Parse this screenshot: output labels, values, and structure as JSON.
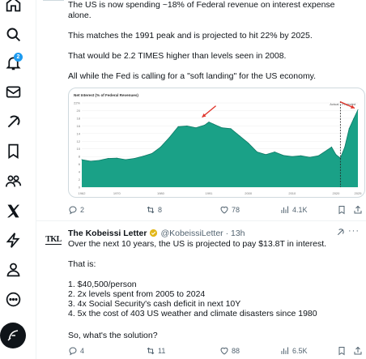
{
  "nav": {
    "items": [
      "home-icon",
      "search-icon",
      "notifications-icon",
      "messages-icon",
      "grok-icon",
      "bookmarks-icon",
      "communities-icon",
      "x-premium-icon",
      "verified-orgs-icon",
      "profile-icon",
      "more-icon"
    ],
    "notification_count": "2"
  },
  "tweet1": {
    "text_top": "The US is now spending ~18% of Federal revenue on interest expense alone.",
    "p2": "This matches the 1991 peak and is projected to hit 22% by 2025.",
    "p3": "That would be 2.2 TIMES higher than levels seen in 2008.",
    "p4": "All while the Fed is calling for a \"soft landing\" for the US economy.",
    "actions": {
      "replies": "2",
      "reposts": "8",
      "likes": "78",
      "views": "4.1K"
    }
  },
  "tweet2": {
    "avatar_text": "TKL",
    "name": "The Kobeissi Letter",
    "handle": "@KobeissiLetter · 13h",
    "intro": "Over the next 10 years, the US is projected to pay $13.8T in interest.",
    "that_is": "That is:",
    "list": [
      "1. $40,500/person",
      "2. 2x levels spent from 2005 to 2024",
      "3. 4x Social Security's cash deficit in next 10Y",
      "4. 5x the cost of 403 US weather and climate disasters since 1980"
    ],
    "question": "So, what's the solution?",
    "actions": {
      "replies": "4",
      "reposts": "11",
      "likes": "88",
      "views": "6.5K"
    }
  },
  "chart_data": {
    "type": "area",
    "title": "Net Interest (% of Federal Revenues)",
    "ylim": [
      0,
      22
    ],
    "yticks": [
      "22%",
      "20",
      "18",
      "16",
      "14",
      "12",
      "10",
      "8",
      "6",
      "4",
      "2",
      "0"
    ],
    "xticks": [
      "1962",
      "1970",
      "1980",
      "1991",
      "2000",
      "2010",
      "2020",
      "2025"
    ],
    "labels": {
      "actual": "Actual",
      "projected": "Projected"
    },
    "x": [
      1962,
      1964,
      1966,
      1968,
      1970,
      1972,
      1974,
      1976,
      1978,
      1980,
      1982,
      1984,
      1986,
      1988,
      1990,
      1991,
      1992,
      1994,
      1996,
      1998,
      2000,
      2002,
      2004,
      2006,
      2008,
      2010,
      2012,
      2014,
      2016,
      2018,
      2019,
      2020,
      2021,
      2022,
      2023,
      2024,
      2025
    ],
    "values": [
      7.2,
      6.8,
      7.0,
      7.5,
      7.6,
      7.2,
      7.5,
      8.1,
      8.8,
      10.5,
      13.0,
      15.8,
      16.0,
      15.5,
      16.2,
      17.0,
      16.5,
      15.5,
      15.3,
      13.4,
      11.5,
      9.2,
      8.5,
      9.2,
      8.3,
      8.0,
      8.2,
      7.8,
      8.2,
      9.7,
      10.5,
      8.5,
      7.6,
      10.5,
      15.3,
      17.8,
      20.2
    ],
    "colors": {
      "fill": "#1aa187",
      "line": "#0e7a66",
      "arrow": "#e0362c",
      "divider": "#222222"
    }
  }
}
